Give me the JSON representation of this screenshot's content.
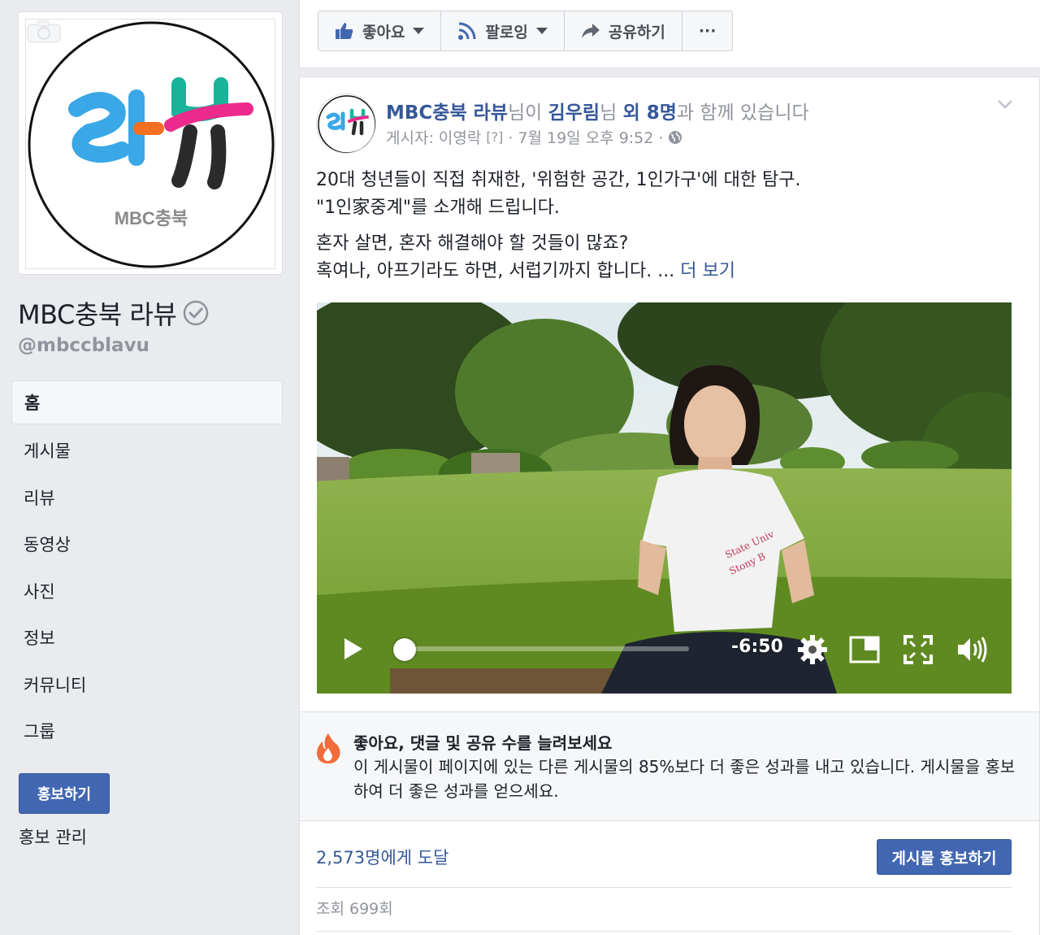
{
  "page": {
    "name": "MBC충북 라뷰",
    "handle": "@mbccblavu",
    "logo_text": "라뷰",
    "logo_sub": "MBC충북"
  },
  "nav": {
    "items": [
      {
        "label": "홈",
        "active": true
      },
      {
        "label": "게시물"
      },
      {
        "label": "리뷰"
      },
      {
        "label": "동영상"
      },
      {
        "label": "사진"
      },
      {
        "label": "정보"
      },
      {
        "label": "커뮤니티"
      },
      {
        "label": "그룹"
      }
    ],
    "promote_label": "홍보하기",
    "promo_manage_label": "홍보 관리"
  },
  "actions": {
    "like": "좋아요",
    "follow": "팔로잉",
    "share": "공유하기",
    "more": "···"
  },
  "post": {
    "author": "MBC충북 라뷰",
    "with_prefix": "님이 ",
    "with_person": "김우림",
    "with_mid": "님 ",
    "with_others": "외 8명",
    "with_suffix": "과 함께 있습니다",
    "posted_by": "게시자: 이영락",
    "help": "[?]",
    "timestamp": "· 7월 19일 오후 9:52 ·",
    "line1": "20대 청년들이 직접 취재한, '위험한 공간, 1인가구'에 대한 탐구.",
    "line2": "\"1인家중계\"를 소개해 드립니다.",
    "line3": "혼자 살면, 혼자 해결해야 할 것들이 많죠?",
    "line4": "혹여나, 아프기라도 하면, 서럽기까지 합니다. ... ",
    "see_more": "더 보기",
    "video_time": "-6:50",
    "video_progress": 0.0,
    "shirt_text_1": "State Univ",
    "shirt_text_2": "Stony B"
  },
  "insight": {
    "title": "좋아요, 댓글 및 공유 수를 늘려보세요",
    "body": "이 게시물이 페이지에 있는 다른 게시물의 85%보다 더 좋은 성과를 내고 있습니다. 게시물을 홍보하여 더 좋은 성과를 얻으세요."
  },
  "stats": {
    "reach": "2,573명에게 도달",
    "boost_label": "게시물 홍보하기",
    "views": "조회 699회"
  },
  "colors": {
    "brand": "#4267b2",
    "link": "#365899",
    "logo_blue": "#3aa7e6",
    "logo_orange": "#f36f21",
    "logo_pink": "#ec2a8b",
    "logo_teal": "#19b39a"
  }
}
